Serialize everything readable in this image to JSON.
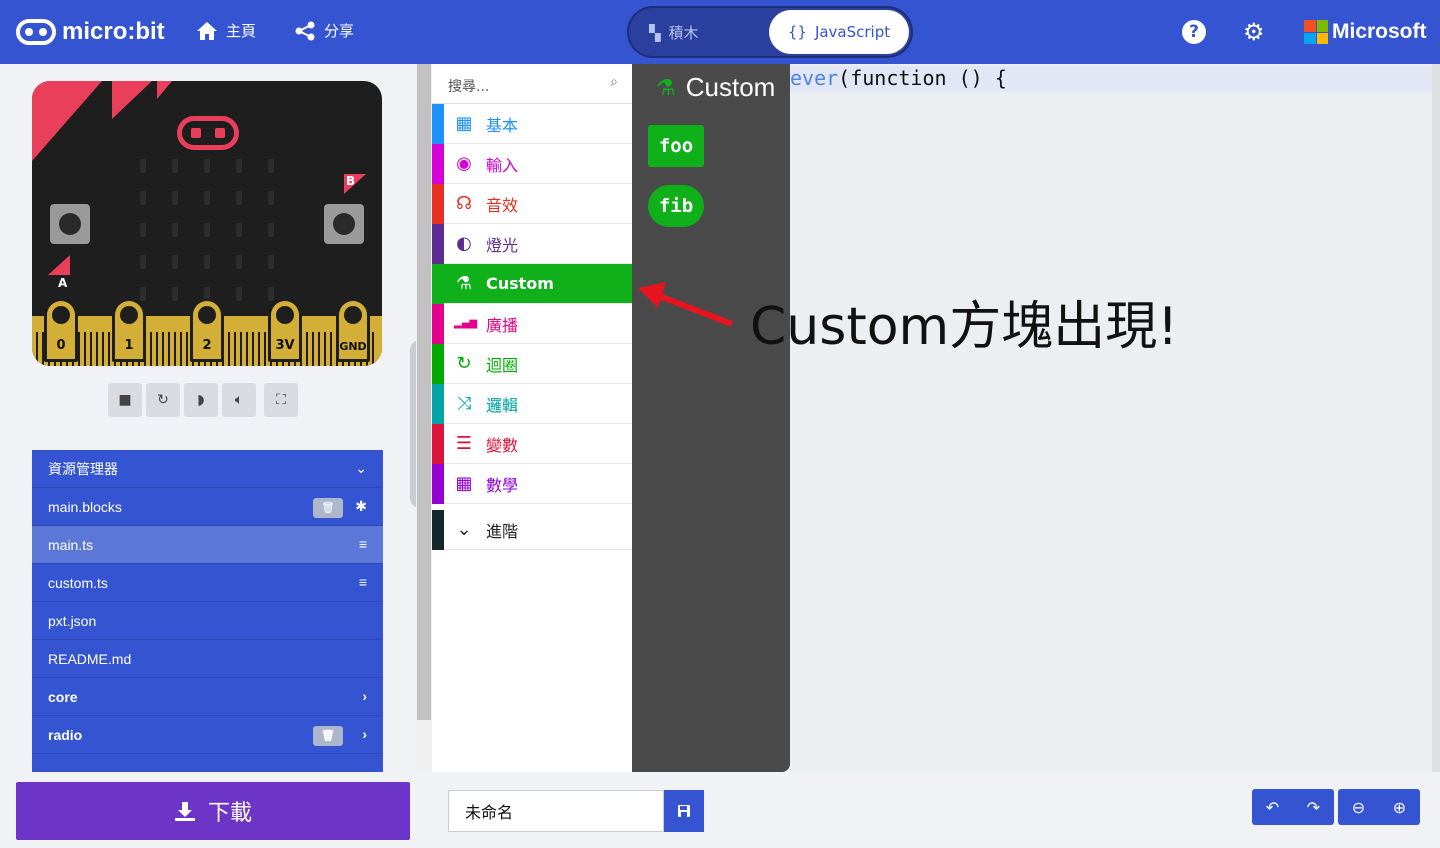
{
  "header": {
    "logo_text": "micro:bit",
    "nav_home": "主頁",
    "nav_share": "分享",
    "toggle_blocks": "積木",
    "toggle_js": "JavaScript",
    "microsoft": "Microsoft",
    "brand_color": "#3454d1"
  },
  "simulator": {
    "pins": [
      "0",
      "1",
      "2",
      "3V",
      "GND"
    ],
    "button_a": "A",
    "button_b": "B"
  },
  "explorer": {
    "title": "資源管理器",
    "files": [
      {
        "name": "main.blocks"
      },
      {
        "name": "main.ts"
      },
      {
        "name": "custom.ts"
      },
      {
        "name": "pxt.json"
      },
      {
        "name": "README.md"
      },
      {
        "name": "core"
      },
      {
        "name": "radio"
      }
    ]
  },
  "toolbox": {
    "search_placeholder": "搜尋...",
    "categories": [
      {
        "label": "基本",
        "color": "#1e90ff"
      },
      {
        "label": "輸入",
        "color": "#d400d4"
      },
      {
        "label": "音效",
        "color": "#e63022"
      },
      {
        "label": "燈光",
        "color": "#5c2d91"
      },
      {
        "label": "Custom",
        "color": "#10b01a"
      },
      {
        "label": "廣播",
        "color": "#e3008c"
      },
      {
        "label": "迴圈",
        "color": "#00aa00"
      },
      {
        "label": "邏輯",
        "color": "#00a4a6"
      },
      {
        "label": "變數",
        "color": "#dc143c"
      },
      {
        "label": "數學",
        "color": "#9400d3"
      }
    ],
    "advanced": "進階"
  },
  "flyout": {
    "title": "Custom",
    "blocks": [
      "foo",
      "fib"
    ]
  },
  "code": {
    "line1_a": "ever",
    "line1_b": "(function () {"
  },
  "annotation": "Custom方塊出現!",
  "bottom": {
    "download": "下載",
    "project_name": "未命名"
  }
}
